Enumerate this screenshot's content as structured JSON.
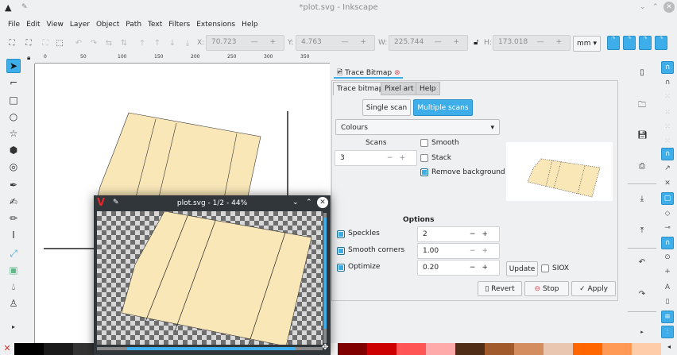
{
  "window": {
    "title": "*plot.svg - Inkscape"
  },
  "menu": [
    "File",
    "Edit",
    "View",
    "Layer",
    "Object",
    "Path",
    "Text",
    "Filters",
    "Extensions",
    "Help"
  ],
  "toolbar": {
    "x_label": "X:",
    "x_value": "70.723",
    "y_label": "Y:",
    "y_value": "4.763",
    "w_label": "W:",
    "w_value": "225.744",
    "h_label": "H:",
    "h_value": "173.018",
    "unit": "mm",
    "stepper": "— +"
  },
  "ruler": {
    "ticks": [
      "0",
      "50",
      "100",
      "150",
      "200",
      "250",
      "300",
      "350"
    ]
  },
  "viewer": {
    "title": "plot.svg - 1/2 - 44%"
  },
  "dock": {
    "tab_label": "Trace Bitmap",
    "inner_tabs": [
      "Trace bitmap",
      "Pixel art",
      "Help"
    ],
    "scan_modes": {
      "single": "Single scan",
      "multiple": "Multiple scans"
    },
    "mode_select": "Colours",
    "scans_label": "Scans",
    "scans_value": "3",
    "smooth": {
      "label": "Smooth",
      "checked": false
    },
    "stack": {
      "label": "Stack",
      "checked": false
    },
    "remove_bg": {
      "label": "Remove background",
      "checked": true
    },
    "options_heading": "Options",
    "options": [
      {
        "label": "Speckles",
        "value": "2",
        "checked": true
      },
      {
        "label": "Smooth corners",
        "value": "1.00",
        "checked": true
      },
      {
        "label": "Optimize",
        "value": "0.20",
        "checked": true
      }
    ],
    "update": "Update",
    "siox": "SIOX",
    "revert": "Revert",
    "stop": "Stop",
    "apply": "Apply"
  },
  "colors": {
    "accent": "#3daee9",
    "shape_fill": "#f9e7b8",
    "viewer_bar": "#31363b"
  }
}
